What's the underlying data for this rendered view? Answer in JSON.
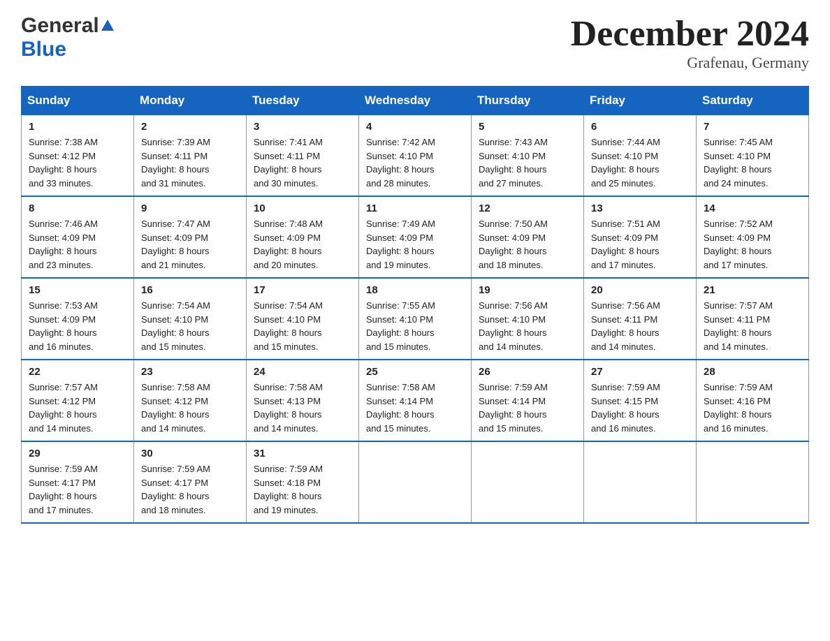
{
  "header": {
    "logo_line1": "General",
    "logo_line2": "Blue",
    "month_title": "December 2024",
    "location": "Grafenau, Germany"
  },
  "weekdays": [
    "Sunday",
    "Monday",
    "Tuesday",
    "Wednesday",
    "Thursday",
    "Friday",
    "Saturday"
  ],
  "weeks": [
    [
      {
        "day": "1",
        "sunrise": "7:38 AM",
        "sunset": "4:12 PM",
        "daylight": "8 hours and 33 minutes."
      },
      {
        "day": "2",
        "sunrise": "7:39 AM",
        "sunset": "4:11 PM",
        "daylight": "8 hours and 31 minutes."
      },
      {
        "day": "3",
        "sunrise": "7:41 AM",
        "sunset": "4:11 PM",
        "daylight": "8 hours and 30 minutes."
      },
      {
        "day": "4",
        "sunrise": "7:42 AM",
        "sunset": "4:10 PM",
        "daylight": "8 hours and 28 minutes."
      },
      {
        "day": "5",
        "sunrise": "7:43 AM",
        "sunset": "4:10 PM",
        "daylight": "8 hours and 27 minutes."
      },
      {
        "day": "6",
        "sunrise": "7:44 AM",
        "sunset": "4:10 PM",
        "daylight": "8 hours and 25 minutes."
      },
      {
        "day": "7",
        "sunrise": "7:45 AM",
        "sunset": "4:10 PM",
        "daylight": "8 hours and 24 minutes."
      }
    ],
    [
      {
        "day": "8",
        "sunrise": "7:46 AM",
        "sunset": "4:09 PM",
        "daylight": "8 hours and 23 minutes."
      },
      {
        "day": "9",
        "sunrise": "7:47 AM",
        "sunset": "4:09 PM",
        "daylight": "8 hours and 21 minutes."
      },
      {
        "day": "10",
        "sunrise": "7:48 AM",
        "sunset": "4:09 PM",
        "daylight": "8 hours and 20 minutes."
      },
      {
        "day": "11",
        "sunrise": "7:49 AM",
        "sunset": "4:09 PM",
        "daylight": "8 hours and 19 minutes."
      },
      {
        "day": "12",
        "sunrise": "7:50 AM",
        "sunset": "4:09 PM",
        "daylight": "8 hours and 18 minutes."
      },
      {
        "day": "13",
        "sunrise": "7:51 AM",
        "sunset": "4:09 PM",
        "daylight": "8 hours and 17 minutes."
      },
      {
        "day": "14",
        "sunrise": "7:52 AM",
        "sunset": "4:09 PM",
        "daylight": "8 hours and 17 minutes."
      }
    ],
    [
      {
        "day": "15",
        "sunrise": "7:53 AM",
        "sunset": "4:09 PM",
        "daylight": "8 hours and 16 minutes."
      },
      {
        "day": "16",
        "sunrise": "7:54 AM",
        "sunset": "4:10 PM",
        "daylight": "8 hours and 15 minutes."
      },
      {
        "day": "17",
        "sunrise": "7:54 AM",
        "sunset": "4:10 PM",
        "daylight": "8 hours and 15 minutes."
      },
      {
        "day": "18",
        "sunrise": "7:55 AM",
        "sunset": "4:10 PM",
        "daylight": "8 hours and 15 minutes."
      },
      {
        "day": "19",
        "sunrise": "7:56 AM",
        "sunset": "4:10 PM",
        "daylight": "8 hours and 14 minutes."
      },
      {
        "day": "20",
        "sunrise": "7:56 AM",
        "sunset": "4:11 PM",
        "daylight": "8 hours and 14 minutes."
      },
      {
        "day": "21",
        "sunrise": "7:57 AM",
        "sunset": "4:11 PM",
        "daylight": "8 hours and 14 minutes."
      }
    ],
    [
      {
        "day": "22",
        "sunrise": "7:57 AM",
        "sunset": "4:12 PM",
        "daylight": "8 hours and 14 minutes."
      },
      {
        "day": "23",
        "sunrise": "7:58 AM",
        "sunset": "4:12 PM",
        "daylight": "8 hours and 14 minutes."
      },
      {
        "day": "24",
        "sunrise": "7:58 AM",
        "sunset": "4:13 PM",
        "daylight": "8 hours and 14 minutes."
      },
      {
        "day": "25",
        "sunrise": "7:58 AM",
        "sunset": "4:14 PM",
        "daylight": "8 hours and 15 minutes."
      },
      {
        "day": "26",
        "sunrise": "7:59 AM",
        "sunset": "4:14 PM",
        "daylight": "8 hours and 15 minutes."
      },
      {
        "day": "27",
        "sunrise": "7:59 AM",
        "sunset": "4:15 PM",
        "daylight": "8 hours and 16 minutes."
      },
      {
        "day": "28",
        "sunrise": "7:59 AM",
        "sunset": "4:16 PM",
        "daylight": "8 hours and 16 minutes."
      }
    ],
    [
      {
        "day": "29",
        "sunrise": "7:59 AM",
        "sunset": "4:17 PM",
        "daylight": "8 hours and 17 minutes."
      },
      {
        "day": "30",
        "sunrise": "7:59 AM",
        "sunset": "4:17 PM",
        "daylight": "8 hours and 18 minutes."
      },
      {
        "day": "31",
        "sunrise": "7:59 AM",
        "sunset": "4:18 PM",
        "daylight": "8 hours and 19 minutes."
      },
      null,
      null,
      null,
      null
    ]
  ],
  "labels": {
    "sunrise": "Sunrise:",
    "sunset": "Sunset:",
    "daylight": "Daylight:"
  }
}
